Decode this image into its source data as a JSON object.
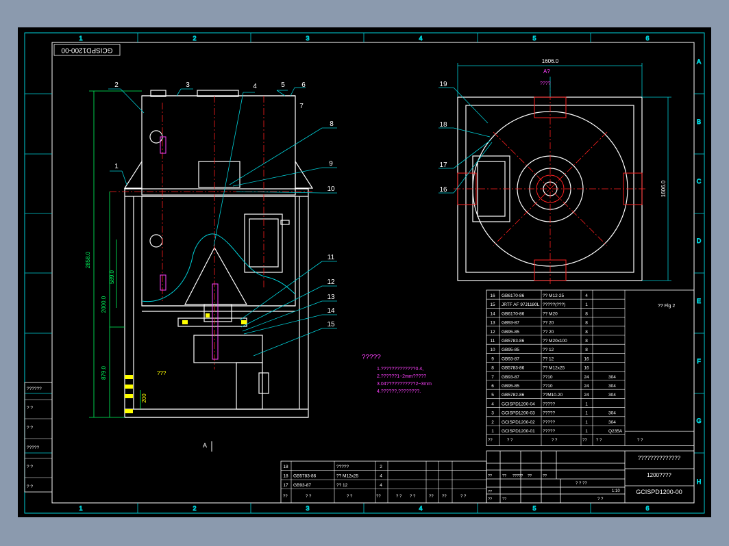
{
  "drawing": {
    "code_rotated": "GCISPD1200-00",
    "grid_cols": [
      "1",
      "2",
      "3",
      "4",
      "5",
      "6"
    ],
    "grid_rows": [
      "A",
      "B",
      "C",
      "D",
      "E",
      "F",
      "G",
      "H"
    ],
    "front_view": {
      "callouts": [
        "1",
        "2",
        "3",
        "4",
        "5",
        "6",
        "7",
        "8",
        "9",
        "10",
        "11",
        "12",
        "13",
        "14",
        "15"
      ],
      "dims": {
        "total_height": "2858.0",
        "lower_height": "2000.0",
        "mid": "589.0",
        "base": "879.0",
        "small": "200"
      },
      "side_note": "???",
      "view_marker": "A"
    },
    "top_view": {
      "callouts": [
        "19",
        "18",
        "17",
        "16"
      ],
      "width_dim": "1606.0",
      "height_dim": "1606.0",
      "view_label": "A?",
      "view_sub": "????"
    },
    "notes": {
      "title": "?????",
      "lines": [
        "1.?????????????0.4,",
        "2.??????1~2mm?????",
        "3.04???????????2~3mm",
        "4.??????,????????."
      ]
    },
    "bom": {
      "rows": [
        {
          "no": "16",
          "code": "GB6170-86",
          "name": "?? M12-25",
          "qty": "4",
          "mat": ""
        },
        {
          "no": "15",
          "code": "JRTF AF 97J1180L",
          "name": "?????(???)",
          "qty": "1",
          "mat": ""
        },
        {
          "no": "14",
          "code": "GB6170-86",
          "name": "?? M20",
          "qty": "8",
          "mat": ""
        },
        {
          "no": "13",
          "code": "GB93-87",
          "name": "?? 20",
          "qty": "8",
          "mat": ""
        },
        {
          "no": "12",
          "code": "GB95-85",
          "name": "?? 20",
          "qty": "8",
          "mat": ""
        },
        {
          "no": "11",
          "code": "GB5783-86",
          "name": "?? M20x100",
          "qty": "8",
          "mat": ""
        },
        {
          "no": "10",
          "code": "GB95-85",
          "name": "?? 12",
          "qty": "8",
          "mat": ""
        },
        {
          "no": "9",
          "code": "GB93-87",
          "name": "?? 12",
          "qty": "16",
          "mat": ""
        },
        {
          "no": "8",
          "code": "GB5783-86",
          "name": "?? M12x25",
          "qty": "16",
          "mat": ""
        },
        {
          "no": "7",
          "code": "GB93-87",
          "name": "??10",
          "qty": "24",
          "mat": "304"
        },
        {
          "no": "6",
          "code": "GB95-85",
          "name": "??10",
          "qty": "24",
          "mat": "304"
        },
        {
          "no": "5",
          "code": "GB5782-86",
          "name": "??M10-20",
          "qty": "24",
          "mat": "304"
        },
        {
          "no": "4",
          "code": "GCISPD1200-04",
          "name": "?????",
          "qty": "1",
          "mat": ""
        },
        {
          "no": "3",
          "code": "GCISPD1200-03",
          "name": "?????",
          "qty": "1",
          "mat": "304"
        },
        {
          "no": "2",
          "code": "GCISPD1200-02",
          "name": "?????",
          "qty": "1",
          "mat": "304"
        },
        {
          "no": "1",
          "code": "GCISPD1200-01",
          "name": "?????",
          "qty": "1",
          "mat": "Q235A"
        }
      ],
      "extra_note": "?? Flg 2",
      "header": [
        "??",
        "?  ?",
        "?  ?",
        "??",
        "?  ?",
        "?  ?"
      ]
    },
    "bom2": {
      "rows": [
        {
          "no": "18",
          "code": "",
          "name": "?????",
          "qty": "2"
        },
        {
          "no": "18",
          "code": "GB5783-86",
          "name": "?? M12x25",
          "qty": "4"
        },
        {
          "no": "17",
          "code": "GB93-87",
          "name": "?? 12",
          "qty": "4"
        }
      ],
      "header": [
        "??",
        "?  ?",
        "?  ?",
        "??",
        "?  ?",
        "?  ?",
        "??",
        "??",
        "?  ?"
      ]
    },
    "title_block": {
      "company": "??????????????",
      "product": "1200????",
      "code": "GCISPD1200-00",
      "weight": "1:10",
      "scale_label": "? ? ??",
      "sheet": "?   ?",
      "small": [
        "??",
        "??",
        "?????",
        "??",
        "??",
        "??",
        "??",
        "??"
      ]
    },
    "left_stamps": [
      "??????",
      "?  ?",
      "?  ?",
      "?????",
      "?  ?",
      "?  ?"
    ]
  }
}
